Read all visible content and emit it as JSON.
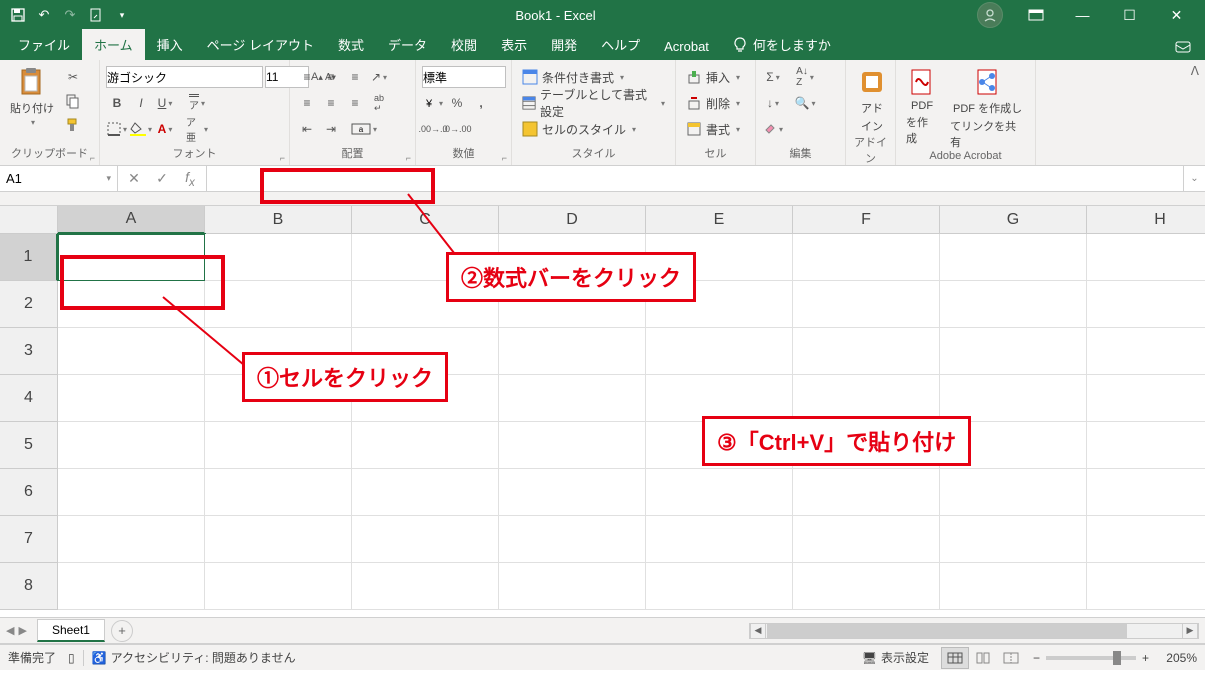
{
  "titlebar": {
    "title": "Book1 - Excel"
  },
  "tabs": {
    "file": "ファイル",
    "home": "ホーム",
    "insert": "挿入",
    "layout": "ページ レイアウト",
    "formulas": "数式",
    "data": "データ",
    "review": "校閲",
    "view": "表示",
    "developer": "開発",
    "help": "ヘルプ",
    "acrobat": "Acrobat",
    "tellme": "何をしますか"
  },
  "ribbon": {
    "clipboard": {
      "paste": "貼り付け",
      "label": "クリップボード"
    },
    "font": {
      "name": "游ゴシック",
      "size": "11",
      "label": "フォント"
    },
    "align": {
      "label": "配置"
    },
    "number": {
      "format": "標準",
      "label": "数値"
    },
    "styles": {
      "cond": "条件付き書式",
      "table": "テーブルとして書式設定",
      "cell": "セルのスタイル",
      "label": "スタイル"
    },
    "cells": {
      "insert": "挿入",
      "delete": "削除",
      "format": "書式",
      "label": "セル"
    },
    "editing": {
      "label": "編集"
    },
    "addin": {
      "label1": "アド",
      "label2": "イン",
      "grouplabel": "アドイン"
    },
    "acrobat": {
      "create1": "PDF",
      "create2": "を作成",
      "share1": "PDF を作成し",
      "share2": "てリンクを共有",
      "label": "Adobe Acrobat"
    }
  },
  "namebox": "A1",
  "columns": [
    "A",
    "B",
    "C",
    "D",
    "E",
    "F",
    "G",
    "H"
  ],
  "rows": [
    "1",
    "2",
    "3",
    "4",
    "5",
    "6",
    "7",
    "8"
  ],
  "sheets": {
    "sheet1": "Sheet1"
  },
  "status": {
    "ready": "準備完了",
    "access": "アクセシビリティ: 問題ありません",
    "display": "表示設定",
    "zoom": "205%"
  },
  "anno": {
    "cell": "①セルをクリック",
    "fbar": "②数式バーをクリック",
    "paste": "③「Ctrl+V」で貼り付け"
  }
}
